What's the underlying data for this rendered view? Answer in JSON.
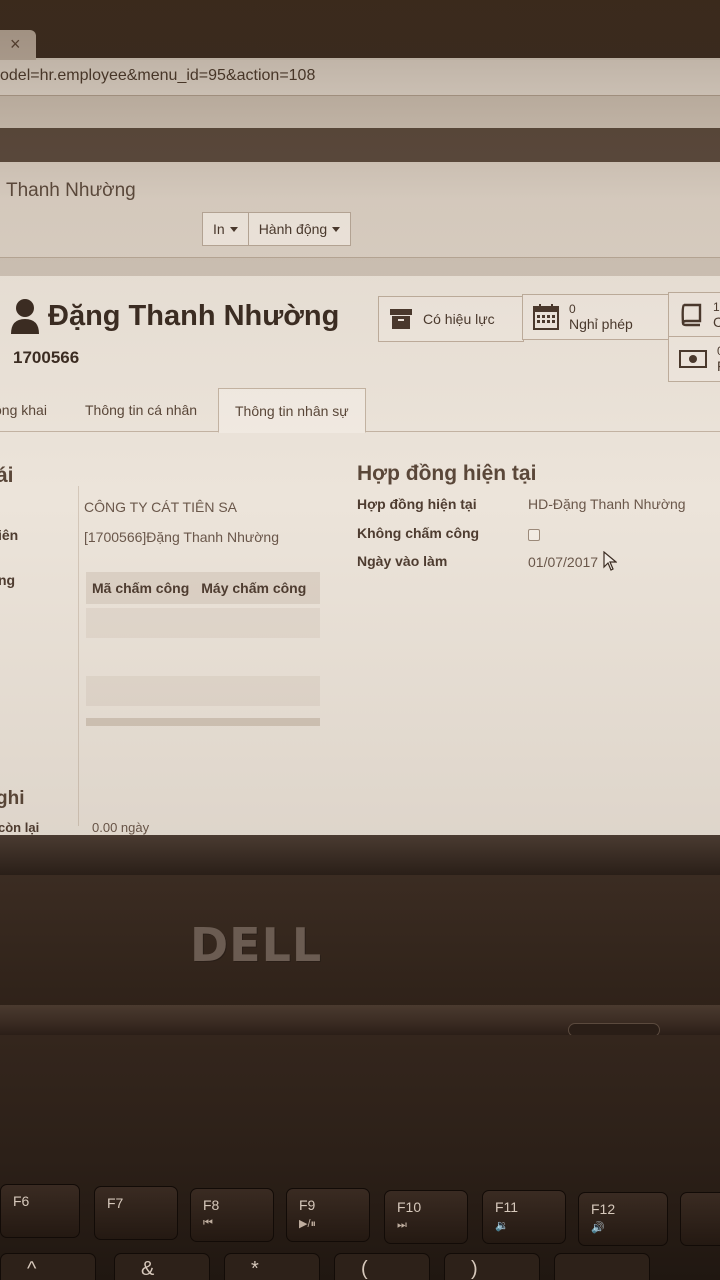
{
  "browser": {
    "tab_close": "×",
    "url": "odel=hr.employee&menu_id=95&action=108"
  },
  "control_panel": {
    "breadcrumb": "Thanh Nhường",
    "print_button": "In",
    "action_button": "Hành động"
  },
  "employee": {
    "name": "Đặng Thanh Nhường",
    "code": "1700566"
  },
  "stat_buttons": [
    {
      "label": "Có hiệu lực",
      "icon": "archive-icon"
    },
    {
      "number": "0",
      "label": "Nghỉ phép",
      "icon": "calendar-icon"
    },
    {
      "number": "1",
      "label": "C",
      "icon": "book-icon"
    },
    {
      "number": "0",
      "label": "F",
      "icon": "money-icon"
    }
  ],
  "tabs": [
    {
      "label": "ông khai"
    },
    {
      "label": "Thông tin cá nhân"
    },
    {
      "label": "Thông tin nhân sự",
      "active": true
    }
  ],
  "left_section": {
    "title": "ái",
    "fields": [
      {
        "label": "",
        "value": "CÔNG TY CÁT TIÊN SA"
      },
      {
        "label": "iên",
        "value": "[1700566]Đặng Thanh Nhường"
      },
      {
        "label": "ng",
        "value": ""
      }
    ],
    "attendance_table": {
      "headers": [
        "Mã chấm công",
        "Máy chấm công"
      ],
      "rows": []
    },
    "next_section_title": "ghi",
    "partial_label": "còn lại",
    "partial_value": "0.00 ngày"
  },
  "contract_section": {
    "title": "Hợp đồng hiện tại",
    "fields": [
      {
        "label": "Hợp đồng hiện tại",
        "value": "HD-Đặng Thanh Nhường"
      },
      {
        "label": "Không chấm công",
        "value": ""
      },
      {
        "label": "Ngày vào làm",
        "value": "01/07/2017"
      }
    ],
    "no_attendance_checked": false
  },
  "laptop": {
    "brand": "DELL",
    "fkeys": [
      {
        "label": "F6",
        "symbol": ""
      },
      {
        "label": "F7",
        "symbol": ""
      },
      {
        "label": "F8",
        "symbol": "⏮"
      },
      {
        "label": "F9",
        "symbol": "▶/⏸"
      },
      {
        "label": "F10",
        "symbol": "⏭"
      },
      {
        "label": "F11",
        "symbol": "🔉"
      },
      {
        "label": "F12",
        "symbol": "🔊"
      }
    ],
    "row2_keys": [
      "^",
      "&",
      "*",
      "(",
      ")"
    ]
  }
}
